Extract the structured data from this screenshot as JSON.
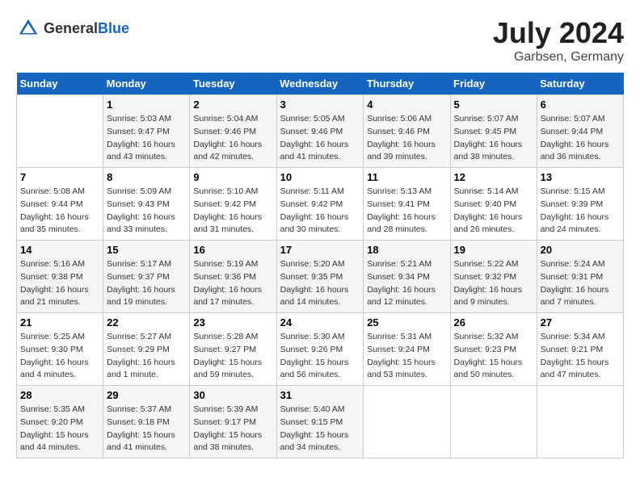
{
  "header": {
    "logo_general": "General",
    "logo_blue": "Blue",
    "month": "July 2024",
    "location": "Garbsen, Germany"
  },
  "days_of_week": [
    "Sunday",
    "Monday",
    "Tuesday",
    "Wednesday",
    "Thursday",
    "Friday",
    "Saturday"
  ],
  "weeks": [
    [
      {
        "day": "",
        "detail": ""
      },
      {
        "day": "1",
        "detail": "Sunrise: 5:03 AM\nSunset: 9:47 PM\nDaylight: 16 hours\nand 43 minutes."
      },
      {
        "day": "2",
        "detail": "Sunrise: 5:04 AM\nSunset: 9:46 PM\nDaylight: 16 hours\nand 42 minutes."
      },
      {
        "day": "3",
        "detail": "Sunrise: 5:05 AM\nSunset: 9:46 PM\nDaylight: 16 hours\nand 41 minutes."
      },
      {
        "day": "4",
        "detail": "Sunrise: 5:06 AM\nSunset: 9:46 PM\nDaylight: 16 hours\nand 39 minutes."
      },
      {
        "day": "5",
        "detail": "Sunrise: 5:07 AM\nSunset: 9:45 PM\nDaylight: 16 hours\nand 38 minutes."
      },
      {
        "day": "6",
        "detail": "Sunrise: 5:07 AM\nSunset: 9:44 PM\nDaylight: 16 hours\nand 36 minutes."
      }
    ],
    [
      {
        "day": "7",
        "detail": "Sunrise: 5:08 AM\nSunset: 9:44 PM\nDaylight: 16 hours\nand 35 minutes."
      },
      {
        "day": "8",
        "detail": "Sunrise: 5:09 AM\nSunset: 9:43 PM\nDaylight: 16 hours\nand 33 minutes."
      },
      {
        "day": "9",
        "detail": "Sunrise: 5:10 AM\nSunset: 9:42 PM\nDaylight: 16 hours\nand 31 minutes."
      },
      {
        "day": "10",
        "detail": "Sunrise: 5:11 AM\nSunset: 9:42 PM\nDaylight: 16 hours\nand 30 minutes."
      },
      {
        "day": "11",
        "detail": "Sunrise: 5:13 AM\nSunset: 9:41 PM\nDaylight: 16 hours\nand 28 minutes."
      },
      {
        "day": "12",
        "detail": "Sunrise: 5:14 AM\nSunset: 9:40 PM\nDaylight: 16 hours\nand 26 minutes."
      },
      {
        "day": "13",
        "detail": "Sunrise: 5:15 AM\nSunset: 9:39 PM\nDaylight: 16 hours\nand 24 minutes."
      }
    ],
    [
      {
        "day": "14",
        "detail": "Sunrise: 5:16 AM\nSunset: 9:38 PM\nDaylight: 16 hours\nand 21 minutes."
      },
      {
        "day": "15",
        "detail": "Sunrise: 5:17 AM\nSunset: 9:37 PM\nDaylight: 16 hours\nand 19 minutes."
      },
      {
        "day": "16",
        "detail": "Sunrise: 5:19 AM\nSunset: 9:36 PM\nDaylight: 16 hours\nand 17 minutes."
      },
      {
        "day": "17",
        "detail": "Sunrise: 5:20 AM\nSunset: 9:35 PM\nDaylight: 16 hours\nand 14 minutes."
      },
      {
        "day": "18",
        "detail": "Sunrise: 5:21 AM\nSunset: 9:34 PM\nDaylight: 16 hours\nand 12 minutes."
      },
      {
        "day": "19",
        "detail": "Sunrise: 5:22 AM\nSunset: 9:32 PM\nDaylight: 16 hours\nand 9 minutes."
      },
      {
        "day": "20",
        "detail": "Sunrise: 5:24 AM\nSunset: 9:31 PM\nDaylight: 16 hours\nand 7 minutes."
      }
    ],
    [
      {
        "day": "21",
        "detail": "Sunrise: 5:25 AM\nSunset: 9:30 PM\nDaylight: 16 hours\nand 4 minutes."
      },
      {
        "day": "22",
        "detail": "Sunrise: 5:27 AM\nSunset: 9:29 PM\nDaylight: 16 hours\nand 1 minute."
      },
      {
        "day": "23",
        "detail": "Sunrise: 5:28 AM\nSunset: 9:27 PM\nDaylight: 15 hours\nand 59 minutes."
      },
      {
        "day": "24",
        "detail": "Sunrise: 5:30 AM\nSunset: 9:26 PM\nDaylight: 15 hours\nand 56 minutes."
      },
      {
        "day": "25",
        "detail": "Sunrise: 5:31 AM\nSunset: 9:24 PM\nDaylight: 15 hours\nand 53 minutes."
      },
      {
        "day": "26",
        "detail": "Sunrise: 5:32 AM\nSunset: 9:23 PM\nDaylight: 15 hours\nand 50 minutes."
      },
      {
        "day": "27",
        "detail": "Sunrise: 5:34 AM\nSunset: 9:21 PM\nDaylight: 15 hours\nand 47 minutes."
      }
    ],
    [
      {
        "day": "28",
        "detail": "Sunrise: 5:35 AM\nSunset: 9:20 PM\nDaylight: 15 hours\nand 44 minutes."
      },
      {
        "day": "29",
        "detail": "Sunrise: 5:37 AM\nSunset: 9:18 PM\nDaylight: 15 hours\nand 41 minutes."
      },
      {
        "day": "30",
        "detail": "Sunrise: 5:39 AM\nSunset: 9:17 PM\nDaylight: 15 hours\nand 38 minutes."
      },
      {
        "day": "31",
        "detail": "Sunrise: 5:40 AM\nSunset: 9:15 PM\nDaylight: 15 hours\nand 34 minutes."
      },
      {
        "day": "",
        "detail": ""
      },
      {
        "day": "",
        "detail": ""
      },
      {
        "day": "",
        "detail": ""
      }
    ]
  ]
}
